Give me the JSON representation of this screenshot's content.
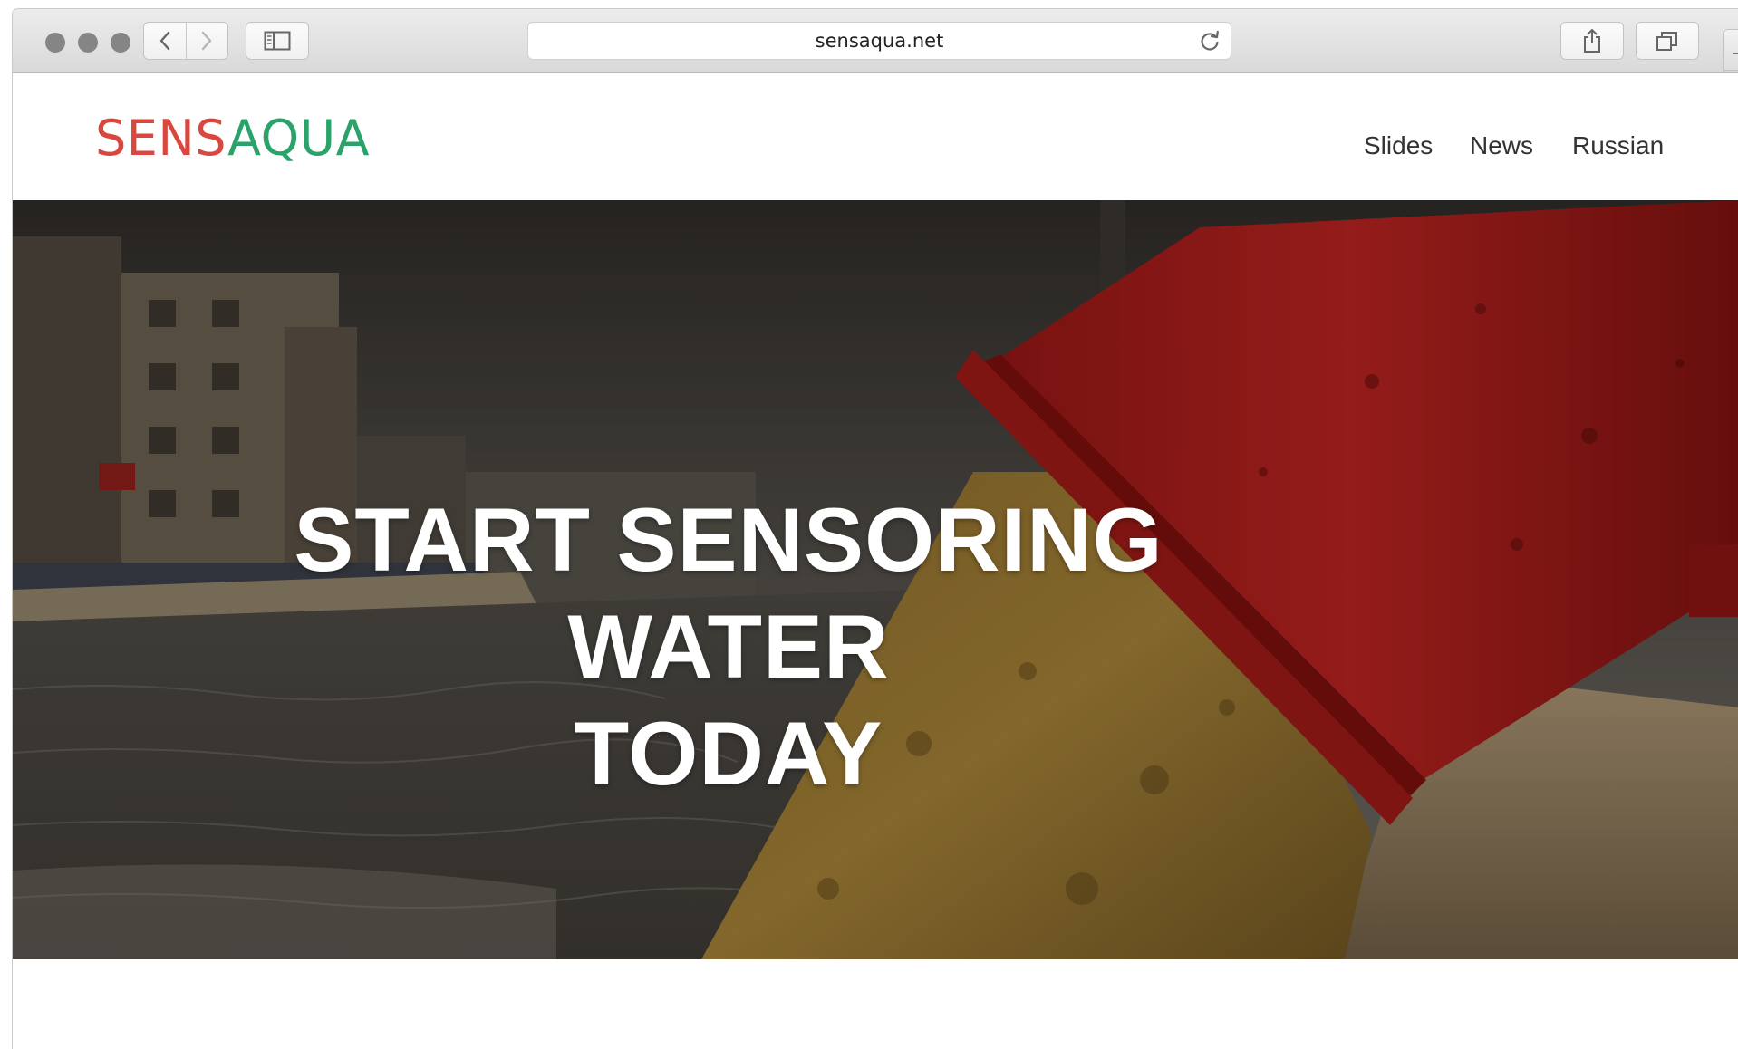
{
  "browser": {
    "url": "sensaqua.net"
  },
  "site": {
    "logo_part1": "SENS",
    "logo_part2": "AQUA",
    "nav": [
      {
        "label": "Slides"
      },
      {
        "label": "News"
      },
      {
        "label": "Russian"
      }
    ]
  },
  "hero": {
    "line1": "START SENSORING WATER",
    "line2": "TODAY"
  },
  "colors": {
    "logo_red": "#d9473f",
    "logo_green": "#2aa26a",
    "pipe_red": "#b21d1a"
  }
}
